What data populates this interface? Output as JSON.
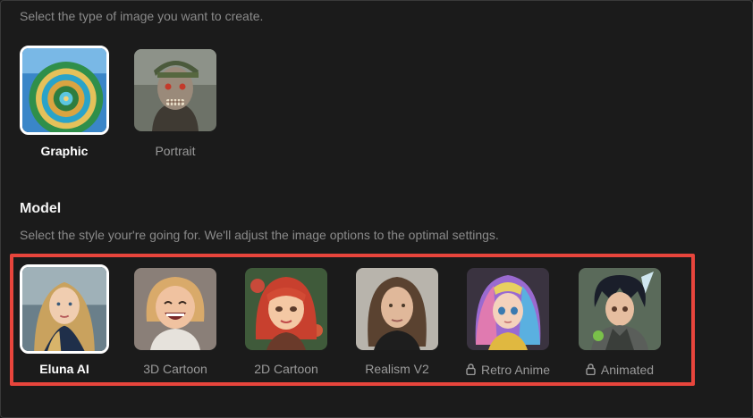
{
  "type_section": {
    "subtitle": "Select the type of image you want to create.",
    "options": [
      {
        "label": "Graphic",
        "icon": "graphic-spiral-thumbnail",
        "selected": true
      },
      {
        "label": "Portrait",
        "icon": "portrait-zombie-thumbnail",
        "selected": false
      }
    ]
  },
  "model_section": {
    "title": "Model",
    "subtitle": "Select the style your're going for. We'll adjust the image options to the optimal settings.",
    "models": [
      {
        "label": "Eluna AI",
        "icon": "eluna-ai-thumbnail",
        "selected": true,
        "locked": false
      },
      {
        "label": "3D Cartoon",
        "icon": "3d-cartoon-thumbnail",
        "selected": false,
        "locked": false
      },
      {
        "label": "2D Cartoon",
        "icon": "2d-cartoon-thumbnail",
        "selected": false,
        "locked": false
      },
      {
        "label": "Realism V2",
        "icon": "realism-v2-thumbnail",
        "selected": false,
        "locked": false
      },
      {
        "label": "Retro Anime",
        "icon": "retro-anime-thumbnail",
        "selected": false,
        "locked": true
      },
      {
        "label": "Animated",
        "icon": "animated-thumbnail",
        "selected": false,
        "locked": true
      }
    ]
  },
  "colors": {
    "background": "#1b1b1b",
    "selected_border": "#ffffff",
    "highlight_border": "#e8453c",
    "muted_text": "#8a8a8a"
  }
}
